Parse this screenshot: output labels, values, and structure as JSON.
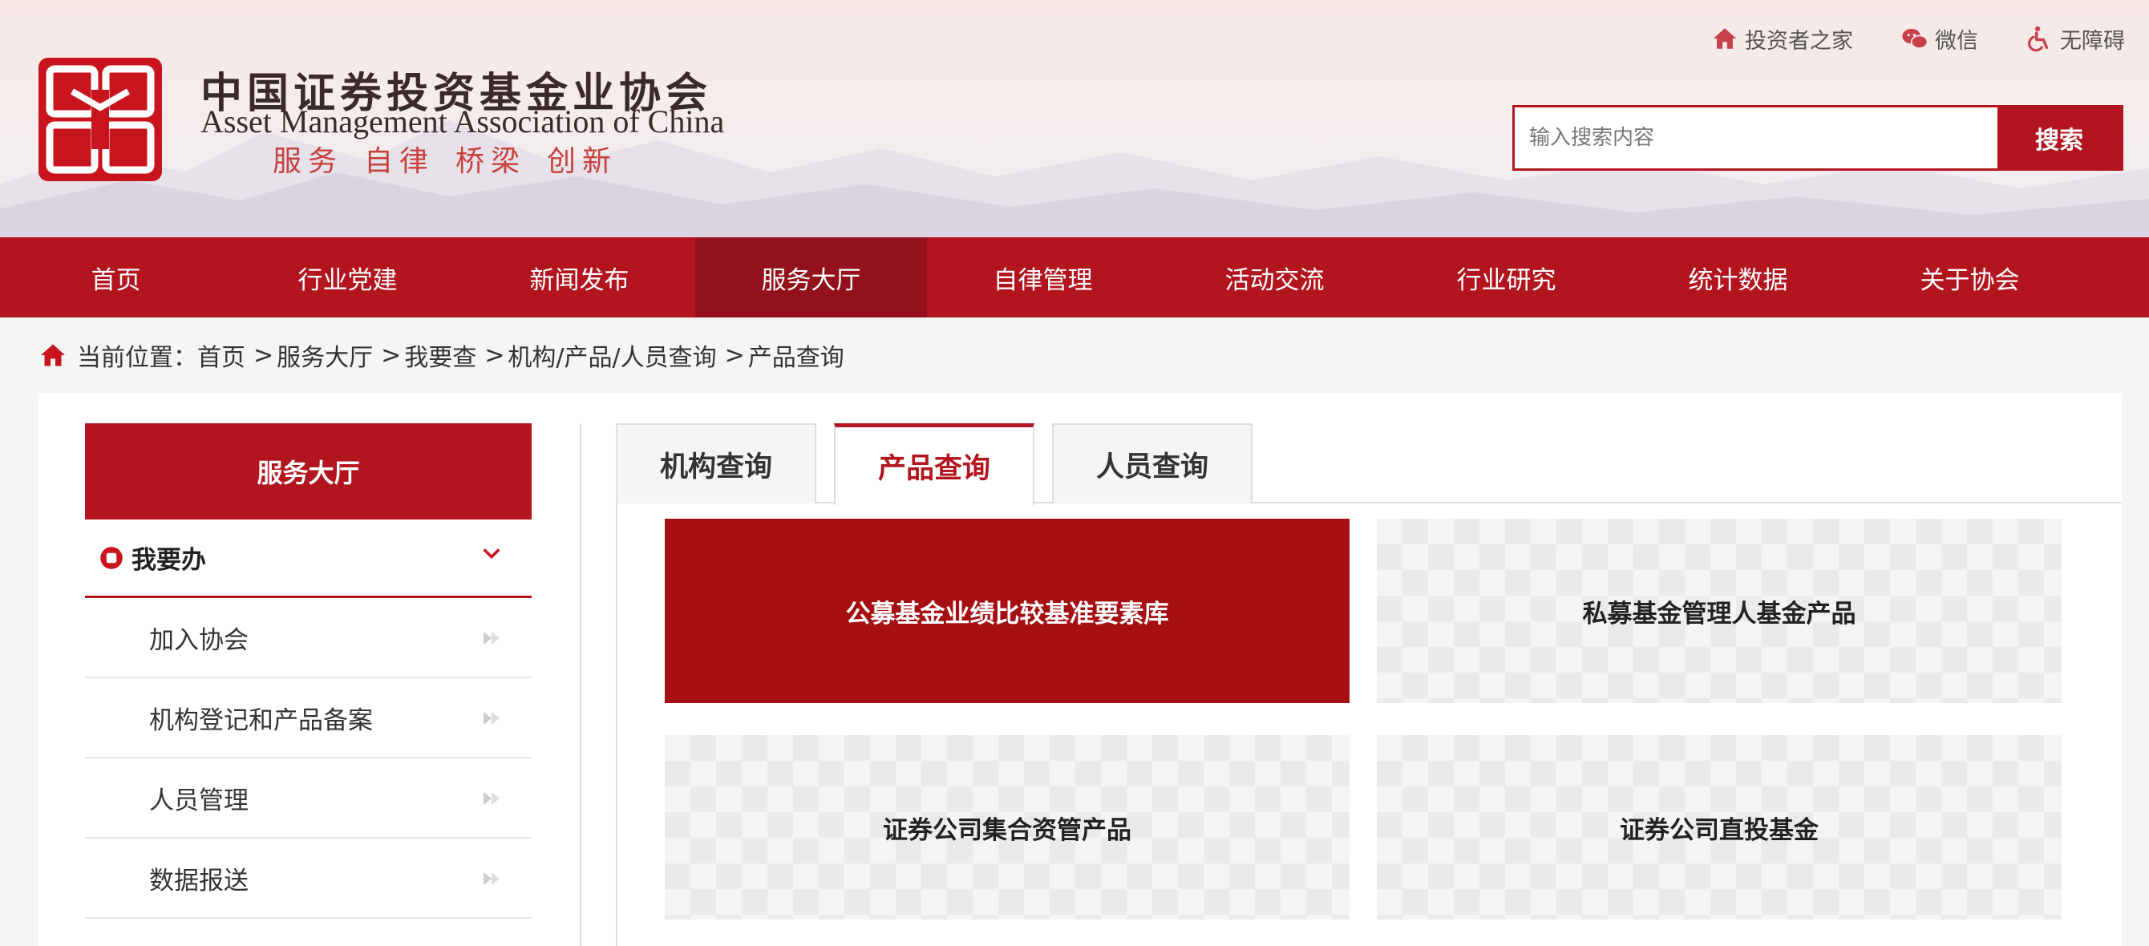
{
  "header": {
    "org_name_cn": "中国证券投资基金业协会",
    "org_name_en": "Asset Management Association of China",
    "slogan": [
      "服务",
      "自律",
      "桥梁",
      "创新"
    ],
    "logo_icon": "amac-seal-logo",
    "brand_color": "#b3151f"
  },
  "toplinks": [
    {
      "label": "投资者之家",
      "icon": "home-icon"
    },
    {
      "label": "微信",
      "icon": "wechat-icon"
    },
    {
      "label": "无障碍",
      "icon": "accessibility-icon"
    }
  ],
  "search": {
    "placeholder": "输入搜索内容",
    "value": "",
    "button_label": "搜索"
  },
  "nav": {
    "items": [
      "首页",
      "行业党建",
      "新闻发布",
      "服务大厅",
      "自律管理",
      "活动交流",
      "行业研究",
      "统计数据",
      "关于协会"
    ],
    "active": "服务大厅"
  },
  "breadcrumb": {
    "prefix": "当前位置：",
    "items": [
      "首页",
      "服务大厅",
      "我要查",
      "机构/产品/人员查询",
      "产品查询"
    ],
    "separator": ">"
  },
  "sidebar": {
    "title": "服务大厅",
    "group_label": "我要办",
    "items": [
      "加入协会",
      "机构登记和产品备案",
      "人员管理",
      "数据报送"
    ]
  },
  "tabs": {
    "items": [
      "机构查询",
      "产品查询",
      "人员查询"
    ],
    "active": "产品查询"
  },
  "cards": [
    {
      "label": "公募基金业绩比较基准要素库",
      "active": true
    },
    {
      "label": "私募基金管理人基金产品",
      "active": false
    },
    {
      "label": "证券公司集合资管产品",
      "active": false
    },
    {
      "label": "证券公司直投基金",
      "active": false
    }
  ]
}
